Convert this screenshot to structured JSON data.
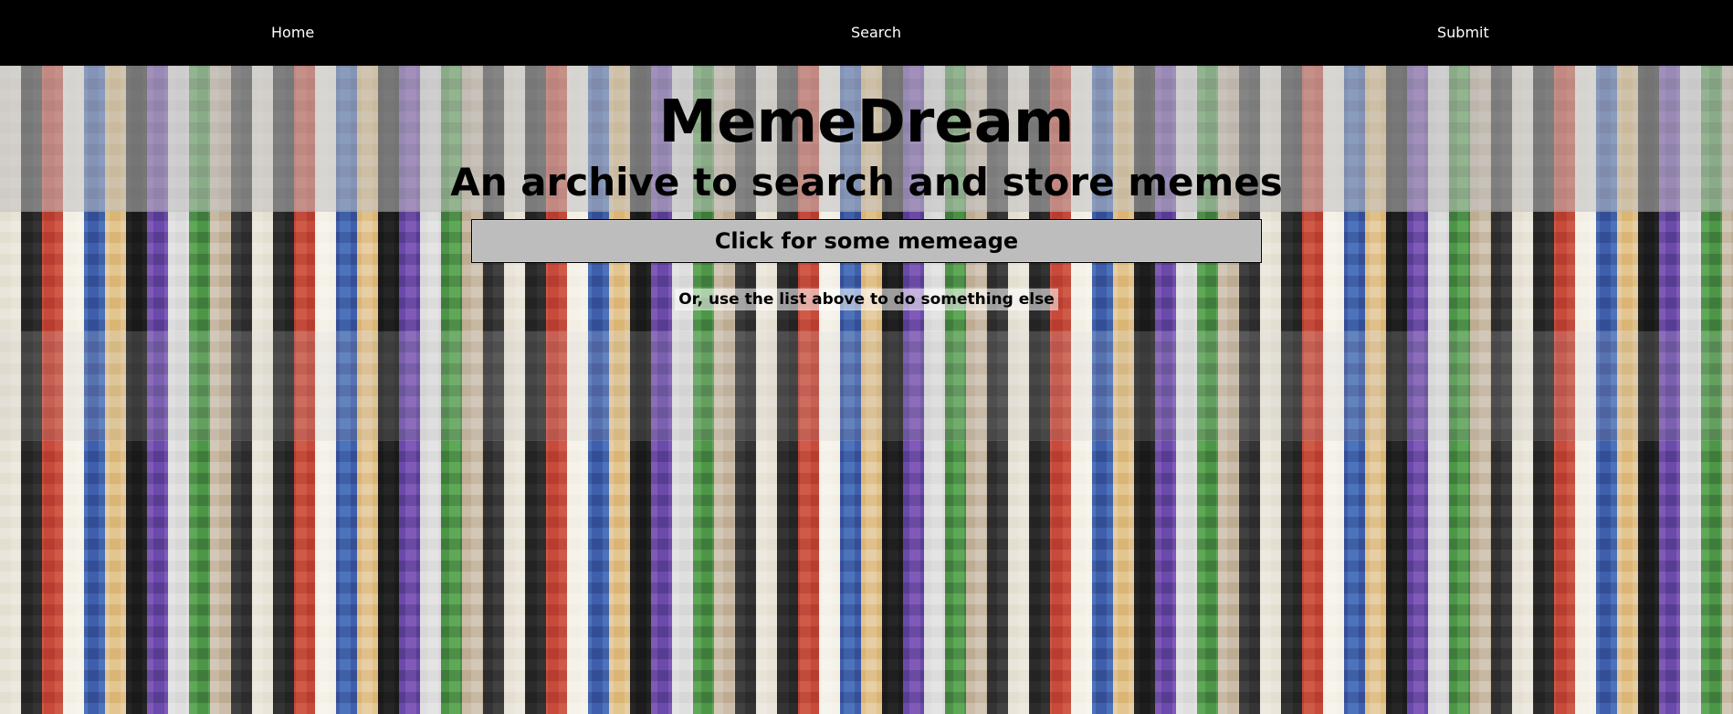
{
  "nav": {
    "home": "Home",
    "search": "Search",
    "submit": "Submit"
  },
  "hero": {
    "title": "MemeDream",
    "subtitle": "An archive to search and store memes",
    "cta_label": "Click for some memeage",
    "hint": "Or, use the list above to do something else"
  },
  "theme": {
    "nav_bg": "#000000",
    "nav_text": "#ffffff",
    "button_bg": "#bdbdbd",
    "text": "#000000"
  }
}
